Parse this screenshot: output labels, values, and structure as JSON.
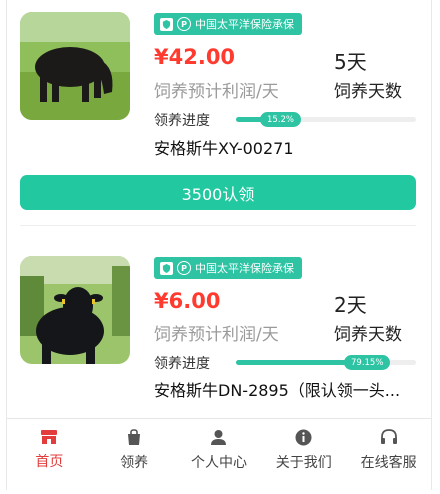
{
  "listings": [
    {
      "badge": "中国太平洋保险承保",
      "price": "¥42.00",
      "price_label": "饲养预计利润/天",
      "days": "5天",
      "days_label": "饲养天数",
      "progress_label": "领养进度",
      "progress_text": "15.2%",
      "progress_value": 0.152,
      "name": "安格斯牛XY-00271",
      "button": "3500认领"
    },
    {
      "badge": "中国太平洋保险承保",
      "price": "¥6.00",
      "price_label": "饲养预计利润/天",
      "days": "2天",
      "days_label": "饲养天数",
      "progress_label": "领养进度",
      "progress_text": "79.15%",
      "progress_value": 0.7915,
      "name": "安格斯牛DN-2895（限认领一头..."
    }
  ],
  "tabbar": {
    "items": [
      {
        "label": "首页",
        "icon": "store-icon",
        "active": true
      },
      {
        "label": "领养",
        "icon": "bag-icon",
        "active": false
      },
      {
        "label": "个人中心",
        "icon": "person-icon",
        "active": false
      },
      {
        "label": "关于我们",
        "icon": "info-icon",
        "active": false
      },
      {
        "label": "在线客服",
        "icon": "headset-icon",
        "active": false
      }
    ]
  },
  "colors": {
    "accent": "#22c8a0",
    "price": "#ff3b30",
    "active_tab": "#e23c3c"
  }
}
